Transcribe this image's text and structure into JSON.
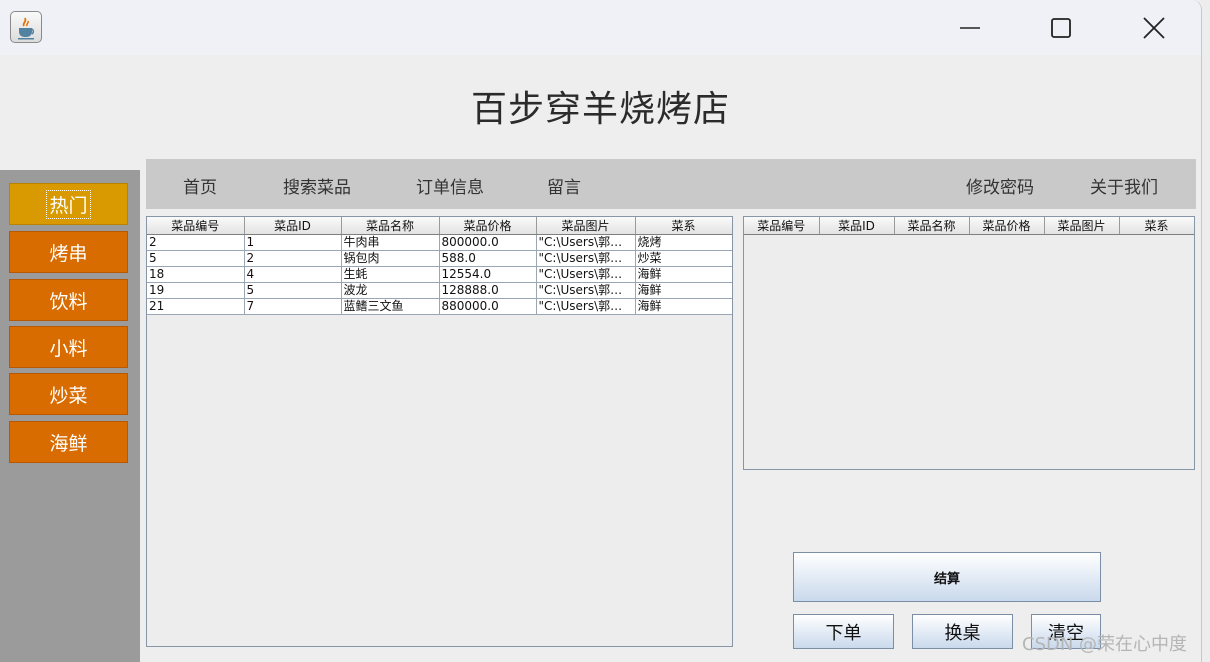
{
  "window": {
    "app_icon": "java-coffee-icon"
  },
  "header": {
    "title": "百步穿羊烧烤店"
  },
  "sidebar": {
    "items": [
      {
        "label": "热门",
        "active": true
      },
      {
        "label": "烤串"
      },
      {
        "label": "饮料"
      },
      {
        "label": "小料"
      },
      {
        "label": "炒菜"
      },
      {
        "label": "海鲜"
      }
    ]
  },
  "nav": {
    "home": "首页",
    "search": "搜索菜品",
    "orders": "订单信息",
    "message": "留言",
    "change_password": "修改密码",
    "about": "关于我们"
  },
  "menu_table": {
    "columns": [
      "菜品编号",
      "菜品ID",
      "菜品名称",
      "菜品价格",
      "菜品图片",
      "菜系"
    ],
    "rows": [
      [
        "2",
        "1",
        "牛肉串",
        "800000.0",
        "\"C:\\Users\\郭文...",
        "烧烤"
      ],
      [
        "5",
        "2",
        "锅包肉",
        "588.0",
        "\"C:\\Users\\郭文...",
        "炒菜"
      ],
      [
        "18",
        "4",
        "生蚝",
        "12554.0",
        "\"C:\\Users\\郭文...",
        "海鲜"
      ],
      [
        "19",
        "5",
        "波龙",
        "128888.0",
        "\"C:\\Users\\郭文...",
        "海鲜"
      ],
      [
        "21",
        "7",
        "蓝鳍三文鱼",
        "880000.0",
        "\"C:\\Users\\郭文...",
        "海鲜"
      ]
    ]
  },
  "cart_table": {
    "columns": [
      "菜品编号",
      "菜品ID",
      "菜品名称",
      "菜品价格",
      "菜品图片",
      "菜系"
    ],
    "rows": []
  },
  "actions": {
    "checkout": "结算",
    "order": "下单",
    "change_table": "换桌",
    "clear": "清空"
  },
  "watermark": "CSDN @荣在心中度",
  "colors": {
    "category_button": "#d86c00",
    "category_active": "#d89a00",
    "sidebar": "#9b9b9b",
    "navbar": "#c9c9c9"
  }
}
